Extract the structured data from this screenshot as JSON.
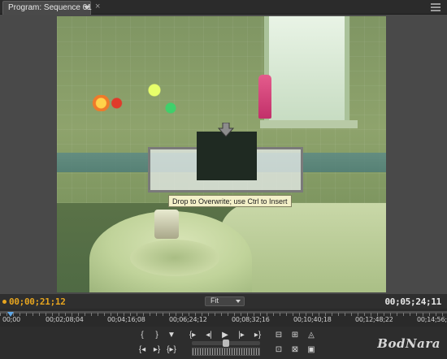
{
  "tab": {
    "label": "Program: Sequence 01",
    "close_glyph": "×"
  },
  "monitor": {
    "tooltip": "Drop to Overwrite; use Ctrl to Insert"
  },
  "timecode": {
    "current": "00;00;21;12",
    "duration": "00;05;24;11",
    "zoom": "Fit"
  },
  "ruler": {
    "ticks": [
      "00;00",
      "00;02;08;04",
      "00;04;16;08",
      "00;06;24;12",
      "00;08;32;16",
      "00;10;40;18",
      "00;12;48;22",
      "00;14;56;"
    ]
  },
  "transport": {
    "row1": [
      "{",
      "}",
      "▼",
      "{▸",
      "◂|",
      "▶",
      "|▸",
      "▸}",
      "⊟",
      "⊞",
      "◬"
    ],
    "row2": [
      "{◂",
      "▸}",
      "{▸}",
      "⊡",
      "⊠",
      "▣"
    ]
  },
  "watermark": "BodNara",
  "colors": {
    "accent_timecode": "#e7a51f",
    "playhead": "#5fa8e8",
    "tooltip_bg": "#f3f0c8"
  }
}
